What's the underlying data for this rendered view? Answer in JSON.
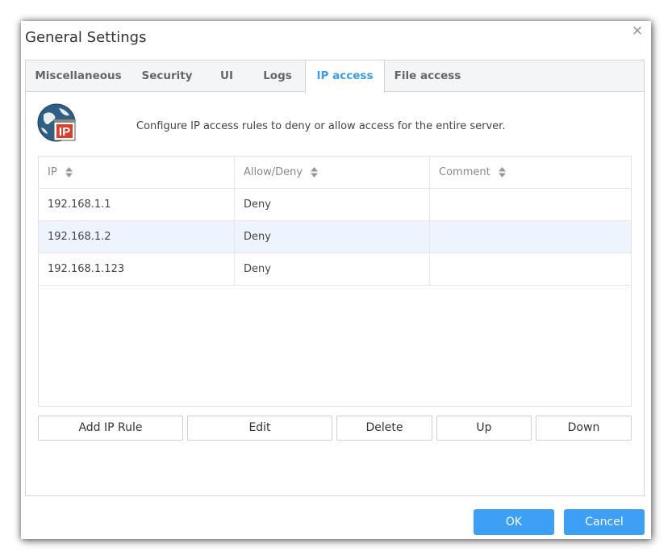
{
  "dialog": {
    "title": "General Settings",
    "close_icon": "close-icon"
  },
  "tabs": [
    {
      "label": "Miscellaneous",
      "active": false
    },
    {
      "label": "Security",
      "active": false
    },
    {
      "label": "UI",
      "active": false
    },
    {
      "label": "Logs",
      "active": false
    },
    {
      "label": "IP access",
      "active": true
    },
    {
      "label": "File access",
      "active": false
    }
  ],
  "content": {
    "icon": "ip-globe-icon",
    "icon_text": "IP",
    "description": "Configure IP access rules to deny or allow access for the entire server."
  },
  "table": {
    "columns": [
      "IP",
      "Allow/Deny",
      "Comment"
    ],
    "rows": [
      {
        "ip": "192.168.1.1",
        "rule": "Deny",
        "comment": "",
        "selected": false
      },
      {
        "ip": "192.168.1.2",
        "rule": "Deny",
        "comment": "",
        "selected": true
      },
      {
        "ip": "192.168.1.123",
        "rule": "Deny",
        "comment": "",
        "selected": false
      }
    ]
  },
  "actions": {
    "add": "Add IP Rule",
    "edit": "Edit",
    "delete": "Delete",
    "up": "Up",
    "down": "Down"
  },
  "footer": {
    "ok": "OK",
    "cancel": "Cancel"
  },
  "colors": {
    "accent": "#3a9be6",
    "primary_button": "#3da0f5",
    "selected_row": "#edf4fd"
  }
}
